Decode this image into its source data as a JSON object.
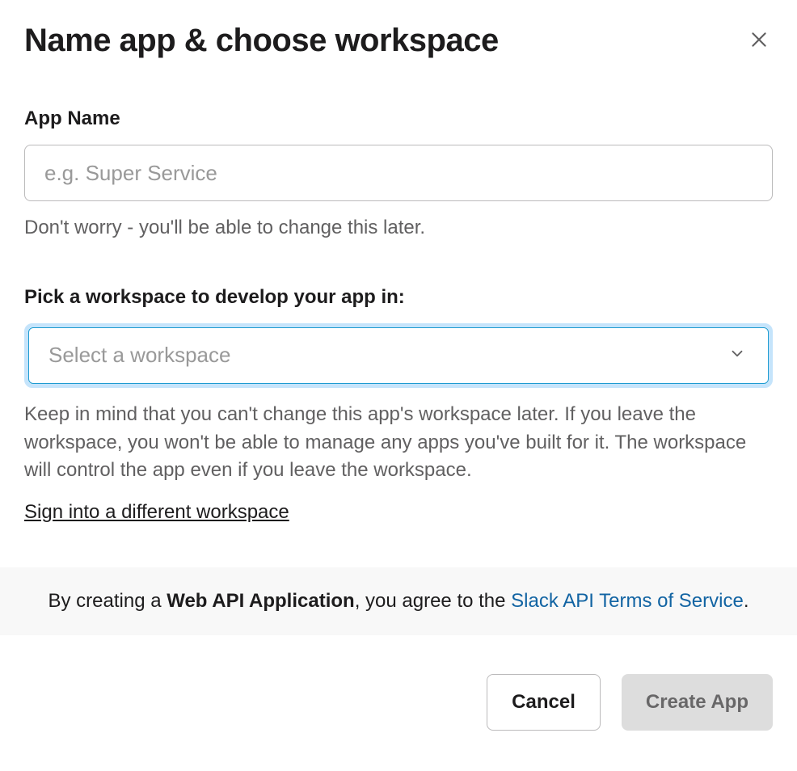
{
  "title": "Name app & choose workspace",
  "appName": {
    "label": "App Name",
    "placeholder": "e.g. Super Service",
    "helper": "Don't worry - you'll be able to change this later."
  },
  "workspace": {
    "label": "Pick a workspace to develop your app in:",
    "placeholder": "Select a workspace",
    "helper": "Keep in mind that you can't change this app's workspace later. If you leave the workspace, you won't be able to manage any apps you've built for it. The workspace will control the app even if you leave the workspace.",
    "signInLink": "Sign into a different workspace"
  },
  "agreement": {
    "prefix": "By creating a ",
    "bold": "Web API Application",
    "middle": ", you agree to the ",
    "linkText": "Slack API Terms of Service",
    "suffix": "."
  },
  "buttons": {
    "cancel": "Cancel",
    "create": "Create App"
  }
}
